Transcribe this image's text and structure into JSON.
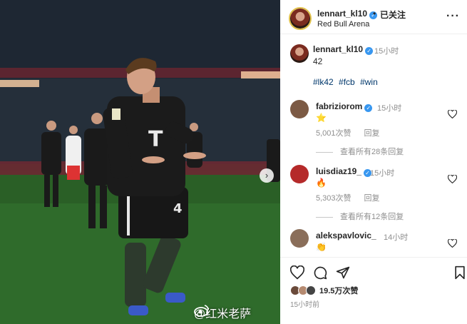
{
  "post": {
    "photo_alt": "",
    "watermark": "@红米老萨",
    "next_icon": "chevron-right-icon"
  },
  "header": {
    "username": "lennart_kl10",
    "dot": "•",
    "follow_label": "已关注",
    "location": "Red Bull Arena",
    "more_icon": "more-icon"
  },
  "caption": {
    "username": "lennart_kl10",
    "time": "15小时",
    "text": "42",
    "hashtags": [
      "#lk42",
      "#fcb",
      "#win"
    ]
  },
  "comments": [
    {
      "username": "fabriziorom",
      "time": "15小时",
      "emoji": "⭐",
      "likes": "5,001次赞",
      "reply_label": "回复",
      "view_replies": "查看所有28条回复"
    },
    {
      "username": "luisdiaz19_",
      "time": "15小时",
      "emoji": "🔥",
      "likes": "5,303次赞",
      "reply_label": "回复",
      "view_replies": "查看所有12条回复"
    },
    {
      "username": "alekspavlovic_",
      "time": "14小时",
      "emoji": "👏"
    }
  ],
  "footer": {
    "likes": "19.5万次赞",
    "post_time": "15小时前"
  },
  "colors": {
    "verified": "#3897f0",
    "hashtag": "#00376b",
    "muted": "#8e8e8e",
    "story_ring": "#e0c14a"
  }
}
